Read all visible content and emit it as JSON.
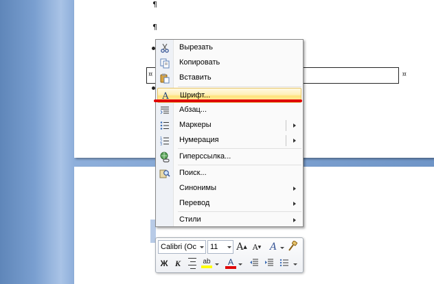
{
  "document": {
    "pilcrow": "¶",
    "cell_mark": "¤"
  },
  "context_menu": {
    "items": [
      {
        "label": "Вырезать",
        "icon": "scissors-icon"
      },
      {
        "label": "Копировать",
        "icon": "copy-icon"
      },
      {
        "label": "Вставить",
        "icon": "paste-icon"
      },
      {
        "label": "Шрифт...",
        "icon": "font-icon",
        "highlighted": true
      },
      {
        "label": "Абзац...",
        "icon": "paragraph-icon"
      },
      {
        "label": "Маркеры",
        "icon": "bullets-icon",
        "submenu": true
      },
      {
        "label": "Нумерация",
        "icon": "numbering-icon",
        "submenu": true
      },
      {
        "label": "Гиперссылка...",
        "icon": "hyperlink-icon"
      },
      {
        "label": "Поиск...",
        "icon": "search-icon"
      },
      {
        "label": "Синонимы",
        "icon": "",
        "submenu": true
      },
      {
        "label": "Перевод",
        "icon": "",
        "submenu": true
      },
      {
        "label": "Стили",
        "icon": "",
        "submenu": true
      }
    ]
  },
  "mini_toolbar": {
    "font_name": "Calibri (Ос",
    "font_size": "11",
    "grow_font": "A",
    "shrink_font": "A",
    "styles_glyph": "A",
    "bold": "Ж",
    "italic": "К",
    "highlight_glyph": "ab",
    "font_color_glyph": "A",
    "highlight_color": "#ffff00",
    "font_color": "#e00000"
  },
  "accent": {
    "red_underline": "#e00000",
    "menu_highlight": "#ffe27a"
  }
}
